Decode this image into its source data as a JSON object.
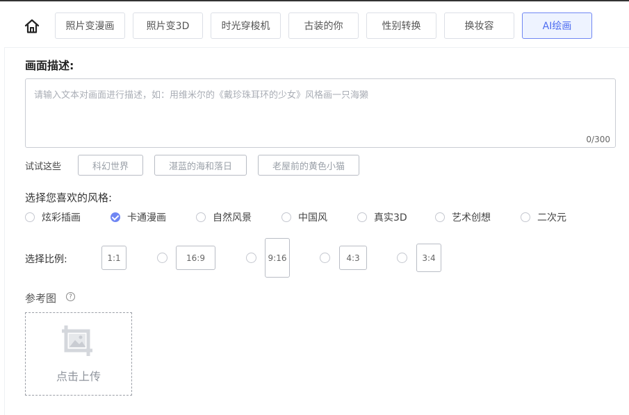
{
  "nav": {
    "home_icon": "home-icon",
    "tabs": [
      {
        "label": "照片变漫画"
      },
      {
        "label": "照片变3D"
      },
      {
        "label": "时光穿梭机"
      },
      {
        "label": "古装的你"
      },
      {
        "label": "性别转换"
      },
      {
        "label": "换妆容"
      },
      {
        "label": "AI绘画",
        "active": true
      }
    ]
  },
  "prompt": {
    "title": "画面描述:",
    "placeholder": "请输入文本对画面进行描述，如：用维米尔的《戴珍珠耳环的少女》风格画一只海獭",
    "count": "0/300"
  },
  "suggestions": {
    "label": "试试这些",
    "chips": [
      "科幻世界",
      "湛蓝的海和落日",
      "老屋前的黄色小猫"
    ]
  },
  "styles": {
    "title": "选择您喜欢的风格:",
    "options": [
      "炫彩插画",
      "卡通漫画",
      "自然风景",
      "中国风",
      "真实3D",
      "艺术创想",
      "二次元"
    ],
    "selected": "卡通漫画"
  },
  "ratio": {
    "label": "选择比例:",
    "options": [
      "1:1",
      "16:9",
      "9:16",
      "4:3",
      "3:4"
    ],
    "selected": "1:1"
  },
  "reference": {
    "label": "参考图",
    "help_icon": "help-icon",
    "help_glyph": "?",
    "upload_icon": "image-upload-icon",
    "upload_text": "点击上传"
  },
  "colors": {
    "accent": "#6f86f3",
    "active_tab_bg": "#eef3ff",
    "border": "#dcdfe6"
  }
}
